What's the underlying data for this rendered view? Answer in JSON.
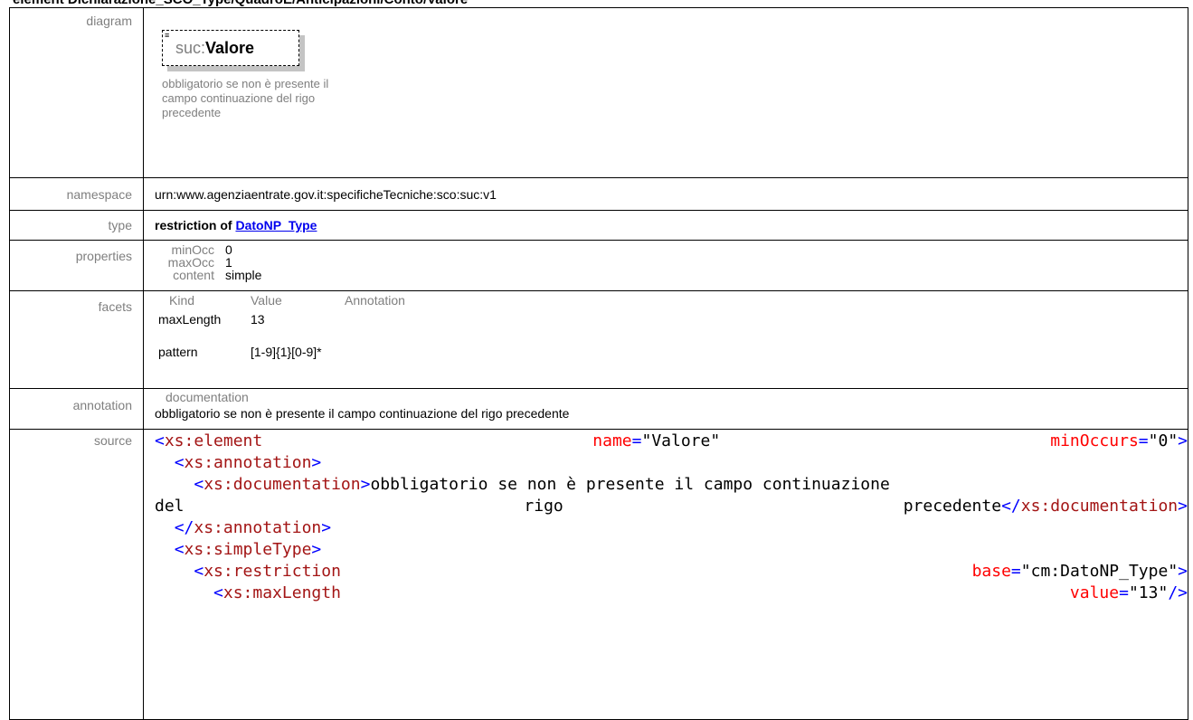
{
  "page_title": "element Dichiarazione_SCO_Type/QuadroE/Anticipazioni/Conto/Valore",
  "rows": {
    "diagram": {
      "label": "diagram",
      "element_prefix": "suc:",
      "element_local": "Valore",
      "element_doc": "obbligatorio se non è presente il campo continuazione del rigo precedente"
    },
    "namespace": {
      "label": "namespace",
      "value": "urn:www.agenziaentrate.gov.it:specificheTecniche:sco:suc:v1"
    },
    "type": {
      "label": "type",
      "prefix": "restriction of ",
      "link": "DatoNP_Type"
    },
    "properties": {
      "label": "properties",
      "items": [
        {
          "k": "minOcc",
          "v": "0"
        },
        {
          "k": "maxOcc",
          "v": "1"
        },
        {
          "k": "content",
          "v": "simple"
        }
      ]
    },
    "facets": {
      "label": "facets",
      "headers": [
        "Kind",
        "Value",
        "Annotation"
      ],
      "items": [
        {
          "kind": "maxLength",
          "value": "13"
        },
        {
          "kind": "pattern",
          "value": "[1-9]{1}[0-9]*"
        }
      ]
    },
    "annotation": {
      "label": "annotation",
      "heading": "documentation",
      "text": "obbligatorio se non è presente il campo continuazione del rigo precedente"
    },
    "source": {
      "label": "source"
    }
  },
  "source_code": {
    "l1": {
      "tag": "xs:element",
      "a1n": "name",
      "a1v": "\"Valore\"",
      "a2n": "minOccurs",
      "a2v": "\"0\""
    },
    "l2": {
      "tag": "xs:annotation"
    },
    "l3": {
      "tag": "xs:documentation",
      "text": "obbligatorio se non è presente il campo continuazione"
    },
    "l4": {
      "w1": "del",
      "w2": "rigo",
      "w3": "precedente",
      "endtag": "xs:documentation"
    },
    "l5": {
      "endtag": "xs:annotation"
    },
    "l6": {
      "tag": "xs:simpleType"
    },
    "l7": {
      "tag": "xs:restriction",
      "a1n": "base",
      "a1v": "\"cm:DatoNP_Type\""
    },
    "l8": {
      "tag": "xs:maxLength",
      "a1n": "value",
      "a1v": "\"13\""
    }
  }
}
